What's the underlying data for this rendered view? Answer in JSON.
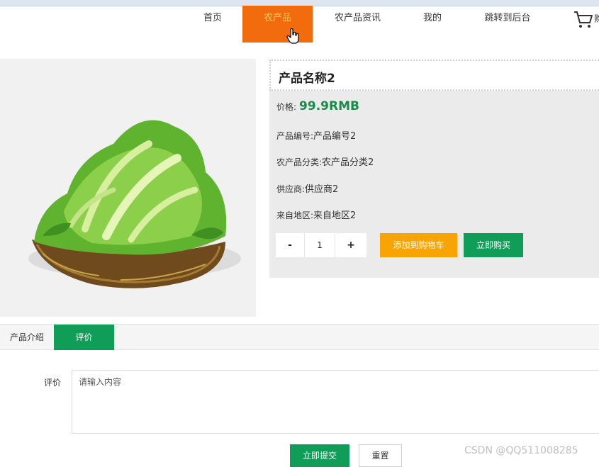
{
  "nav": {
    "items": [
      {
        "label": "首页"
      },
      {
        "label": "农产品"
      },
      {
        "label": "农产品资讯"
      },
      {
        "label": "我的"
      },
      {
        "label": "跳转到后台"
      }
    ],
    "active_index": 1,
    "cart_label": "购"
  },
  "product": {
    "name": "产品名称2",
    "price_label": "价格:",
    "price_value": "99.9RMB",
    "code_label": "产品编号:",
    "code_value": "产品编号2",
    "category_label": "农产品分类:",
    "category_value": "农产品分类2",
    "supplier_label": "供应商:",
    "supplier_value": "供应商2",
    "region_label": "来自地区:",
    "region_value": "来自地区2",
    "image_icon": "lettuce-in-basket"
  },
  "quantity": {
    "minus": "-",
    "value": "1",
    "plus": "+"
  },
  "actions": {
    "add_to_cart": "添加到购物车",
    "buy_now": "立即购买"
  },
  "tabs": {
    "items": [
      {
        "label": "产品介绍"
      },
      {
        "label": "评价"
      }
    ],
    "active_index": 1
  },
  "review": {
    "label": "评价",
    "placeholder": "请输入内容",
    "submit": "立即提交",
    "reset": "重置"
  },
  "watermark": "CSDN @QQ511008285",
  "colors": {
    "nav_active": "#f26b0c",
    "green": "#0f9d58",
    "orange_button": "#f9a405",
    "price": "#1a8a4a"
  }
}
